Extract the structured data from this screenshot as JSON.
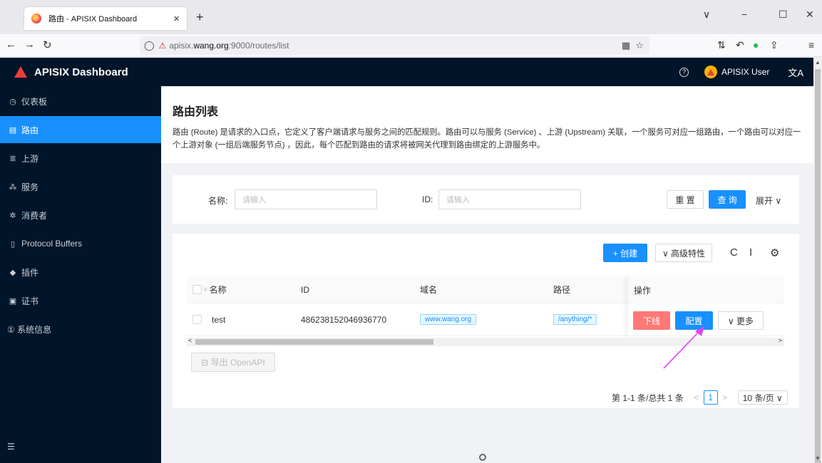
{
  "browser": {
    "tab_title": "路由 - APISIX Dashboard",
    "tab_close": "×",
    "new_tab": "+",
    "url_prefix": "apisix.",
    "url_host": "wang.org",
    "url_suffix": ":9000/routes/list"
  },
  "header": {
    "app_title": "APISIX Dashboard",
    "user_name": "APISIX User",
    "help": "?",
    "lang": "文A"
  },
  "sidebar": {
    "items": [
      {
        "label": "仪表板",
        "icon": "dashboard-icon",
        "glyph": "◷"
      },
      {
        "label": "路由",
        "icon": "route-icon",
        "glyph": "▤"
      },
      {
        "label": "上游",
        "icon": "upstream-icon",
        "glyph": "≣"
      },
      {
        "label": "服务",
        "icon": "service-icon",
        "glyph": "⁂"
      },
      {
        "label": "消费者",
        "icon": "consumer-icon",
        "glyph": "✲"
      },
      {
        "label": "Protocol Buffers",
        "icon": "protocol-icon",
        "glyph": "▯"
      },
      {
        "label": "插件",
        "icon": "plugin-icon",
        "glyph": "◆"
      },
      {
        "label": "证书",
        "icon": "certificate-icon",
        "glyph": "▣"
      },
      {
        "label": "① 系统信息",
        "icon": "",
        "glyph": ""
      }
    ],
    "active_index": 1
  },
  "page": {
    "title": "路由列表",
    "description": "路由 (Route) 是请求的入口点，它定义了客户端请求与服务之间的匹配规则。路由可以与服务 (Service) 、上游 (Upstream) 关联，一个服务可对应一组路由，一个路由可以对应一个上游对象 (一组后端服务节点) ，因此，每个匹配到路由的请求将被网关代理到路由绑定的上游服务中。"
  },
  "search": {
    "name_label": "名称:",
    "name_placeholder": "请输入",
    "id_label": "ID:",
    "id_placeholder": "请输入",
    "reset_label": "重 置",
    "query_label": "查 询",
    "expand_label": "展开 ∨"
  },
  "table": {
    "create_label": "+ 创建",
    "advanced_label": "∨ 高级特性",
    "columns": [
      "名称",
      "ID",
      "域名",
      "路径",
      "操作"
    ],
    "rows": [
      {
        "name": "test",
        "id": "486238152046936770",
        "host": "www.wang.org",
        "path": "/anything/*"
      }
    ],
    "offline_label": "下线",
    "config_label": "配置",
    "more_label": "∨ 更多",
    "export_label": "⊟ 导出 OpenAPI"
  },
  "pagination": {
    "summary": "第 1-1 条/总共 1 条",
    "current": "1",
    "page_size": "10 条/页 ∨"
  },
  "colors": {
    "primary": "#1890ff",
    "danger": "#ff7875",
    "sidebar_bg": "#001529",
    "annotation_arrow": "#e040fb"
  }
}
